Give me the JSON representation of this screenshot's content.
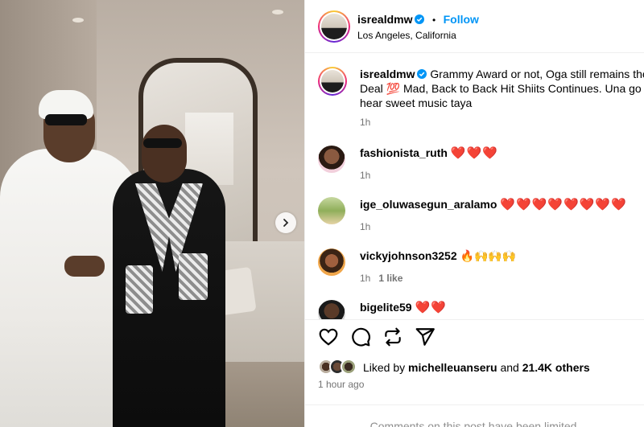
{
  "post": {
    "username": "isrealdmw",
    "location": "Los Angeles, California",
    "follow_label": "Follow",
    "dot": "•",
    "caption_user": "isrealdmw",
    "caption_text": "Grammy Award or not, Oga still remains the Deal 💯 Mad, Back to Back Hit Shiits Continues. Una go hear sweet music taya",
    "caption_time": "1h",
    "brand_color": "#0095f6"
  },
  "comments": [
    {
      "username": "fashionista_ruth",
      "text": "❤️❤️❤️",
      "time": "1h",
      "likes": ""
    },
    {
      "username": "ige_oluwasegun_aralamo",
      "text": "❤️❤️❤️❤️❤️❤️❤️❤️",
      "time": "1h",
      "likes": ""
    },
    {
      "username": "vickyjohnson3252",
      "text": "🔥🙌🙌🙌",
      "time": "1h",
      "likes": "1 like"
    },
    {
      "username": "bigelite59",
      "text": "❤️❤️",
      "time": "",
      "likes": ""
    }
  ],
  "actions": {
    "like_icon": "heart-outline-icon",
    "comment_icon": "comment-bubble-icon",
    "share_icon": "repost-icon",
    "send_icon": "send-paper-plane-icon"
  },
  "likes": {
    "prefix": "Liked by",
    "user": "michelleuanseru",
    "middle": "and",
    "count": "21.4K others"
  },
  "timestamp": "1 hour ago",
  "limited_notice": "Comments on this post have been limited."
}
